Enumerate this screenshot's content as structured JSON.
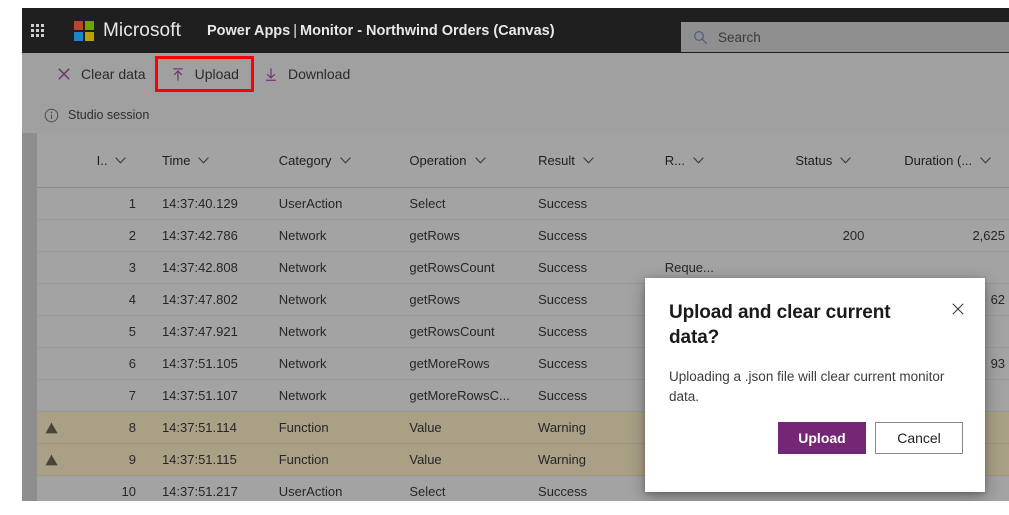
{
  "suite": {
    "waffle_label": "app-launcher",
    "brand": "Microsoft",
    "app_name": "Power Apps",
    "separator": "|",
    "page_name": "Monitor - Northwind Orders (Canvas)",
    "search_placeholder": "Search"
  },
  "commandbar": {
    "clear_data": "Clear data",
    "upload": "Upload",
    "download": "Download",
    "highlight_color": "#ff0000"
  },
  "session": {
    "label": "Studio session"
  },
  "table": {
    "columns": [
      {
        "key": "flag",
        "label": ""
      },
      {
        "key": "id",
        "label": "I.."
      },
      {
        "key": "time",
        "label": "Time"
      },
      {
        "key": "category",
        "label": "Category"
      },
      {
        "key": "operation",
        "label": "Operation"
      },
      {
        "key": "result",
        "label": "Result"
      },
      {
        "key": "request",
        "label": "R..."
      },
      {
        "key": "status",
        "label": "Status"
      },
      {
        "key": "duration",
        "label": "Duration (..."
      }
    ],
    "rows": [
      {
        "flag": "",
        "id": "1",
        "time": "14:37:40.129",
        "category": "UserAction",
        "operation": "Select",
        "result": "Success",
        "request": "",
        "status": "",
        "duration": "",
        "warning": false
      },
      {
        "flag": "",
        "id": "2",
        "time": "14:37:42.786",
        "category": "Network",
        "operation": "getRows",
        "result": "Success",
        "request": "",
        "status": "200",
        "duration": "2,625",
        "warning": false
      },
      {
        "flag": "",
        "id": "3",
        "time": "14:37:42.808",
        "category": "Network",
        "operation": "getRowsCount",
        "result": "Success",
        "request": "Reque...",
        "status": "",
        "duration": "",
        "warning": false
      },
      {
        "flag": "",
        "id": "4",
        "time": "14:37:47.802",
        "category": "Network",
        "operation": "getRows",
        "result": "Success",
        "request": "",
        "status": "",
        "duration": "62",
        "warning": false
      },
      {
        "flag": "",
        "id": "5",
        "time": "14:37:47.921",
        "category": "Network",
        "operation": "getRowsCount",
        "result": "Success",
        "request": "",
        "status": "",
        "duration": "",
        "warning": false
      },
      {
        "flag": "warning-icon",
        "id": "6",
        "time": "14:37:51.105",
        "category": "Network",
        "operation": "getMoreRows",
        "result": "Success",
        "request": "",
        "status": "",
        "duration": "93",
        "warning": false
      },
      {
        "flag": "",
        "id": "7",
        "time": "14:37:51.107",
        "category": "Network",
        "operation": "getMoreRowsC...",
        "result": "Success",
        "request": "",
        "status": "",
        "duration": "",
        "warning": false
      },
      {
        "flag": "warning-icon",
        "id": "8",
        "time": "14:37:51.114",
        "category": "Function",
        "operation": "Value",
        "result": "Warning",
        "request": "",
        "status": "",
        "duration": "",
        "warning": true
      },
      {
        "flag": "warning-icon",
        "id": "9",
        "time": "14:37:51.115",
        "category": "Function",
        "operation": "Value",
        "result": "Warning",
        "request": "",
        "status": "",
        "duration": "",
        "warning": true
      },
      {
        "flag": "",
        "id": "10",
        "time": "14:37:51.217",
        "category": "UserAction",
        "operation": "Select",
        "result": "Success",
        "request": "",
        "status": "",
        "duration": "",
        "warning": false
      }
    ]
  },
  "dialog": {
    "title": "Upload and clear current data?",
    "body": "Uploading a .json file will clear current monitor data.",
    "primary_button": "Upload",
    "secondary_button": "Cancel",
    "close_label": "Close",
    "primary_color": "#742774"
  }
}
